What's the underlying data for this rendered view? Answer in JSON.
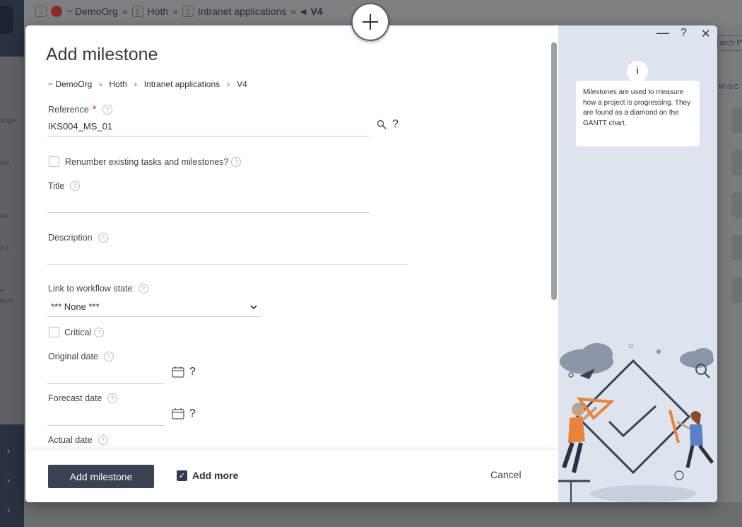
{
  "background": {
    "breadcrumb": [
      "~ DemoOrg",
      "Hoth",
      "Intranet applications",
      "V4"
    ],
    "side_texts": [
      "udget",
      "ord",
      "ect",
      "v a",
      "e",
      "tems"
    ],
    "search_placeholder": "arch P",
    "misc_label": "MISC"
  },
  "modal": {
    "title": "Add milestone",
    "breadcrumb": [
      "~ DemoOrg",
      "Hoth",
      "Intranet applications",
      "V4"
    ],
    "reference": {
      "label": "Reference",
      "value": "IKS004_MS_01"
    },
    "renumber": {
      "label": "Renumber existing tasks and milestones?",
      "checked": false
    },
    "title_field": {
      "label": "Title",
      "value": ""
    },
    "description": {
      "label": "Description",
      "value": ""
    },
    "workflow": {
      "label": "Link to workflow state",
      "selected": "*** None ***"
    },
    "critical": {
      "label": "Critical",
      "checked": false
    },
    "original_date": {
      "label": "Original date",
      "value": ""
    },
    "forecast_date": {
      "label": "Forecast date",
      "value": ""
    },
    "actual_date": {
      "label": "Actual date",
      "value": ""
    },
    "qmark": "?",
    "help_glyph": "?",
    "required_mark": "*"
  },
  "footer": {
    "submit_label": "Add milestone",
    "add_more_label": "Add more",
    "add_more_checked": true,
    "cancel_label": "Cancel"
  },
  "right_panel": {
    "minimize": "—",
    "help": "?",
    "close": "✕",
    "info_icon": "i",
    "info_text": "Milestones are used to measure how a project is progressing. They are found as a diamond on the GANTT chart."
  },
  "colors": {
    "primary_button": "#3b4252",
    "required": "#d9302b",
    "panel_bg": "#dde4ee",
    "illustration_orange": "#e8833a"
  }
}
